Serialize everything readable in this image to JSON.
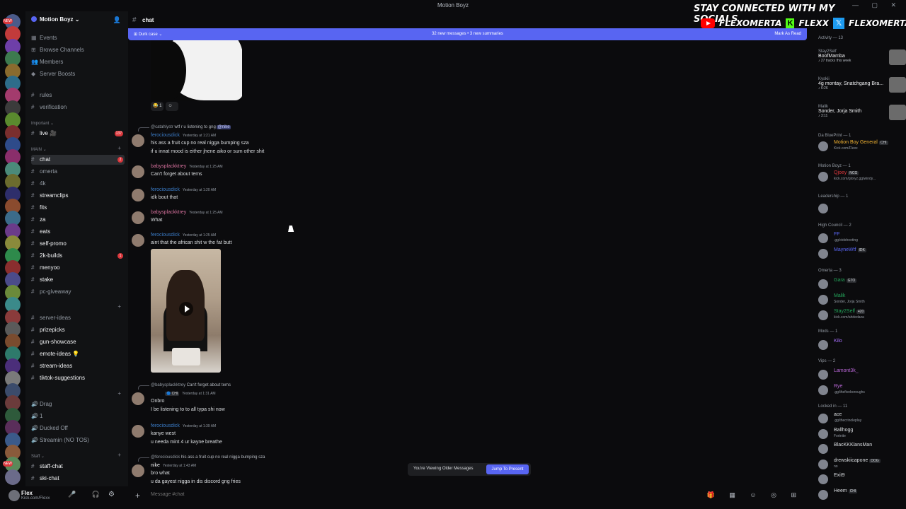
{
  "window": {
    "title": "Motion Boyz"
  },
  "overlay": {
    "headline": "STAY CONNECTED WITH MY SOCIALS",
    "youtube": "FLEXOMERTA",
    "kick": "FLEXX",
    "x": "FLEXOMERTA"
  },
  "guilds": {
    "badges": [
      "NEW",
      "NEW"
    ]
  },
  "server": {
    "name": "Motion Boyz",
    "top_items": [
      "Events",
      "Browse Channels",
      "Members",
      "Server Boosts"
    ],
    "info_channels": [
      "rules",
      "verification"
    ],
    "cat_important": "Important",
    "live_channel": "live",
    "live_count": "137",
    "cat_main": "MAIN",
    "main_channels": [
      {
        "name": "chat",
        "count": "2"
      },
      {
        "name": "omerta",
        "count": ""
      },
      {
        "name": "4k",
        "count": ""
      },
      {
        "name": "streamclips",
        "count": ""
      },
      {
        "name": "fits",
        "count": ""
      },
      {
        "name": "za",
        "count": ""
      },
      {
        "name": "eats",
        "count": ""
      },
      {
        "name": "self-promo",
        "count": ""
      },
      {
        "name": "2k-builds",
        "count": "1"
      },
      {
        "name": "menyoo",
        "count": ""
      },
      {
        "name": "stake",
        "count": ""
      },
      {
        "name": "pc-giveaway",
        "count": ""
      }
    ],
    "other_channels": [
      "server-ideas",
      "prizepicks",
      "gun-showcase",
      "emote-ideas 💡",
      "stream-ideas",
      "tiktok-suggestions"
    ],
    "voice_channels": [
      "Drag",
      "1",
      "Ducked Off",
      "Streamin (NO TOS)"
    ],
    "cat_staff": "Staff",
    "staff_channels": [
      "staff-chat",
      "ski-chat"
    ]
  },
  "user": {
    "name": "Flex",
    "status": "Kick.com/Flexx"
  },
  "channel": {
    "name": "chat",
    "thread": "Durk case",
    "new_messages": "32 new messages",
    "summaries": "3 new summaries",
    "mark_read": "Mark As Read"
  },
  "messages": [
    {
      "reply_user": "@catahlystr",
      "reply_text": "wtf r u listening to gng",
      "reply_mention": "@nike",
      "user": "ferociousdick",
      "time": "Yesterday at 1:21 AM",
      "lines": [
        "his ass a fruit cup no real nigga bumping sza",
        "if u innat mood is either jhene aiko or sum other shit"
      ]
    },
    {
      "user": "babysplackktrey",
      "time": "Yesterday at 1:25 AM",
      "lines": [
        "Can't forget about tems"
      ]
    },
    {
      "user": "ferociousdick",
      "time": "Yesterday at 1:20 AM",
      "lines": [
        "idk bout that"
      ]
    },
    {
      "user": "babysplackktrey",
      "time": "Yesterday at 1:25 AM",
      "lines": [
        "What"
      ]
    },
    {
      "user": "ferociousdick",
      "time": "Yesterday at 1:25 AM",
      "lines": [
        "aint that the african shit w the fat butt"
      ]
    },
    {
      "reply_user": "@babysplackktrey",
      "reply_text": "Can't forget about tems",
      "user": "Onbro",
      "tag": "CHI",
      "time": "Yesterday at 1:31 AM",
      "lines": [
        "Onbro",
        "I be listening to to all typa shi now"
      ]
    },
    {
      "user": "ferociousdick",
      "time": "Yesterday at 1:39 AM",
      "lines": [
        "kanye west",
        "u needa mint 4 ur kayne breathe"
      ]
    },
    {
      "reply_user": "@ferociousdick",
      "reply_text": "his ass a fruit cup no real nigga bumping sza",
      "user": "nike",
      "time": "Yesterday at 1:43 AM",
      "lines": [
        "bro what",
        "u da gayest nigga in dis discord gng fries"
      ]
    }
  ],
  "reactions": [
    {
      "emoji": "😂",
      "count": "1"
    },
    {
      "emoji": "☺",
      "count": ""
    }
  ],
  "older_banner": {
    "text": "You're Viewing Older Messages",
    "button": "Jump To Present"
  },
  "composer": {
    "placeholder": "Message #chat"
  },
  "members": {
    "activity_header": "Activity — 13",
    "activity": [
      {
        "name": "Stay2Self",
        "title": "BoofMamba",
        "sub": "27 tracks this week"
      },
      {
        "name": "Kyskii",
        "title": "4g montay, Snatchgang Bra...",
        "sub": "6:26"
      },
      {
        "name": "Malik",
        "title": "Sonder, Jorja Smith",
        "sub": "3:11"
      }
    ],
    "groups": [
      {
        "role": "Da BluePrint — 1",
        "list": [
          {
            "name": "Motion Boy General",
            "badge": "CHI",
            "status": "Kick.com/Flexx",
            "color": "#f0b232"
          }
        ]
      },
      {
        "role": "Motion Boyz — 1",
        "list": [
          {
            "name": "Qjoey",
            "badge": "NCG",
            "status": "kick.com/gloryz.gg/windy...",
            "color": "#da373c"
          }
        ]
      },
      {
        "role": "Leadership — 1",
        "list": [
          {
            "name": "",
            "badge": "",
            "status": "",
            "color": "#dbdee1"
          }
        ]
      },
      {
        "role": "High Council — 2",
        "list": [
          {
            "name": "FF",
            "badge": "",
            "status": ".gg/ctdshooting",
            "color": "#5865f2"
          },
          {
            "name": "MayneWtf",
            "badge": "IDK",
            "status": "",
            "color": "#5865f2"
          }
        ]
      },
      {
        "role": "Omerta — 3",
        "list": [
          {
            "name": "Gara",
            "badge": "GTO",
            "status": "",
            "color": "#23a55a"
          },
          {
            "name": "Malik",
            "badge": "",
            "status": "Sonder, Jorja Smith",
            "color": "#23a55a"
          },
          {
            "name": "Stay2Self",
            "badge": "420",
            "status": "kick.com/ahdedaza",
            "color": "#23a55a"
          }
        ]
      },
      {
        "role": "Mods — 1",
        "list": [
          {
            "name": "Kilo",
            "badge": "",
            "status": "",
            "color": "#a970ff"
          }
        ]
      },
      {
        "role": "Vips — 2",
        "list": [
          {
            "name": "Lamont3k_",
            "badge": "",
            "status": "",
            "color": "#b967d6"
          },
          {
            "name": "Rye",
            "badge": "",
            "status": ".gg/thefiveboroughs",
            "color": "#b967d6"
          }
        ]
      },
      {
        "role": "Locked in — 11",
        "list": [
          {
            "name": "ace",
            "badge": "",
            "status": ".gg/thecrinoleplay",
            "color": "#dbdee1"
          },
          {
            "name": "Ballhogg",
            "badge": "",
            "status": "Fortnite",
            "color": "#dbdee1"
          },
          {
            "name": "BlacKKKlansMan",
            "badge": "",
            "status": "",
            "color": "#dbdee1"
          },
          {
            "name": "drewskiicapone",
            "badge": "DOG",
            "status": "no",
            "color": "#dbdee1"
          },
          {
            "name": "Exit9",
            "badge": "",
            "status": "",
            "color": "#dbdee1"
          },
          {
            "name": "Heem",
            "badge": "CHI",
            "status": "",
            "color": "#dbdee1"
          }
        ]
      }
    ]
  },
  "colors": {
    "accent": "#5865f2",
    "danger": "#da373c",
    "bg": "#0b0b0d",
    "link_user": "#3b7dc9"
  }
}
